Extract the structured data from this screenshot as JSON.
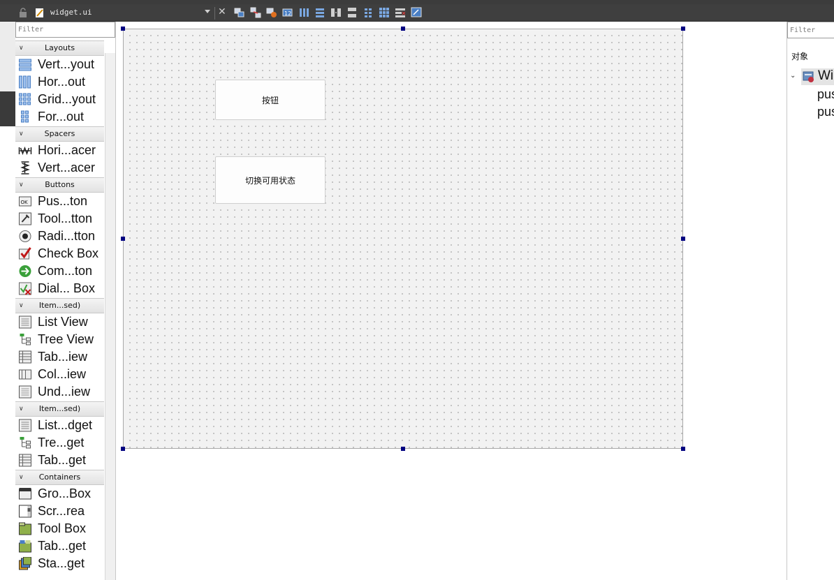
{
  "toolbar": {
    "file_name": "widget.ui",
    "buttons": [
      "edit-widgets-icon",
      "edit-signals-slots-icon",
      "edit-buddies-icon",
      "edit-tab-order-icon",
      "layout-horizontal-icon",
      "layout-vertical-icon",
      "layout-h-splitter-icon",
      "layout-v-splitter-icon",
      "layout-form-icon",
      "layout-grid-icon",
      "break-layout-icon",
      "adjust-size-icon"
    ]
  },
  "widget_box": {
    "filter_placeholder": "Filter",
    "categories": [
      {
        "name": "Layouts",
        "items": [
          "Vert...yout",
          "Hor...out",
          "Grid...yout",
          "For...out"
        ]
      },
      {
        "name": "Spacers",
        "items": [
          "Hori...acer",
          "Vert...acer"
        ]
      },
      {
        "name": "Buttons",
        "items": [
          "Pus...ton",
          "Tool...tton",
          "Radi...tton",
          "Check Box",
          "Com...ton",
          "Dial... Box"
        ]
      },
      {
        "name": "Item...sed)",
        "items": [
          "List View",
          "Tree View",
          "Tab...iew",
          "Col...iew",
          "Und...iew"
        ]
      },
      {
        "name": "Item...sed)",
        "items": [
          "List...dget",
          "Tre...get",
          "Tab...get"
        ]
      },
      {
        "name": "Containers",
        "items": [
          "Gro...Box",
          "Scr...rea",
          "Tool Box",
          "Tab...get",
          "Sta...get"
        ]
      }
    ]
  },
  "form": {
    "button1_label": "按钮",
    "button2_label": "切换可用状态"
  },
  "object_inspector": {
    "filter_placeholder": "Filter",
    "header": "对象",
    "root_label": "Wi",
    "children": [
      "pus",
      "pus"
    ]
  },
  "colors": {
    "toolbar_bg": "#3f3f3f",
    "canvas_bg": "#f2f2f2",
    "handle": "#000080"
  }
}
